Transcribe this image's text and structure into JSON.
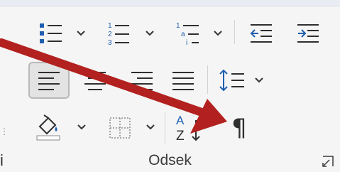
{
  "ribbon": {
    "group_label": "Odsek",
    "left_cut_char": "i"
  },
  "paragraph_group": {
    "row1": [
      {
        "name": "bullets",
        "icon": "bullets-icon",
        "has_dropdown": true
      },
      {
        "name": "numbering",
        "icon": "numbering-icon",
        "has_dropdown": true,
        "glyphs": [
          "1",
          "2",
          "3"
        ]
      },
      {
        "name": "multilevel-list",
        "icon": "multilevel-list-icon",
        "has_dropdown": true,
        "glyphs": [
          "1",
          "a",
          "i"
        ]
      },
      {
        "name": "decrease-indent",
        "icon": "decrease-indent-icon",
        "has_dropdown": false
      },
      {
        "name": "increase-indent",
        "icon": "increase-indent-icon",
        "has_dropdown": false
      }
    ],
    "row2": [
      {
        "name": "align-left",
        "icon": "align-left-icon",
        "selected": true
      },
      {
        "name": "center",
        "icon": "align-center-icon",
        "selected": false
      },
      {
        "name": "align-right",
        "icon": "align-right-icon",
        "selected": false
      },
      {
        "name": "justify",
        "icon": "justify-icon",
        "selected": false
      },
      {
        "name": "line-spacing",
        "icon": "line-spacing-icon",
        "has_dropdown": true
      }
    ],
    "row3": [
      {
        "name": "shading",
        "icon": "paint-bucket-icon",
        "has_dropdown": true
      },
      {
        "name": "borders",
        "icon": "borders-icon",
        "has_dropdown": true
      },
      {
        "name": "sort",
        "icon": "sort-az-icon",
        "glyphs": [
          "A",
          "Z"
        ]
      },
      {
        "name": "show-hide",
        "icon": "pilcrow-icon",
        "glyph": "¶"
      }
    ]
  },
  "annotation": {
    "icon": "red-arrow-icon",
    "color": "#b2211f",
    "points_to": "show-hide"
  },
  "colors": {
    "blue": "#1f5fb0",
    "dark": "#2f2f2f",
    "selected_bg": "#e3e3e3",
    "arrow": "#b2211f"
  }
}
